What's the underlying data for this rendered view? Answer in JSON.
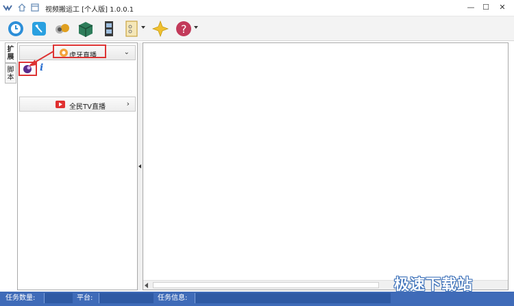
{
  "window": {
    "title": "视频搬运工 [个人版] 1.0.0.1",
    "controls": {
      "minimize": "—",
      "maximize": "☐",
      "close": "✕"
    }
  },
  "toolbar": {
    "buttons": [
      {
        "icon": "clock-icon",
        "color": "#2d8fd8"
      },
      {
        "icon": "scissor-icon",
        "color": "#2aa0e0"
      },
      {
        "icon": "coins-icon",
        "color": "#888888"
      },
      {
        "icon": "box-icon",
        "color": "#2e7d5b"
      },
      {
        "icon": "film-icon",
        "color": "#444444"
      },
      {
        "icon": "document-icon",
        "color": "#e0b84a"
      },
      {
        "icon": "star-icon",
        "color": "#f0c030"
      },
      {
        "icon": "help-icon",
        "color": "#c23a5a"
      }
    ]
  },
  "left_tabs": [
    {
      "label": "扩展",
      "active": true
    },
    {
      "label": "脚本",
      "active": false
    }
  ],
  "accordion": {
    "sections": [
      {
        "label": "虎牙直播",
        "expanded": true,
        "chevron": "⌄",
        "items": [
          {
            "icon": "huya-plugin-icon"
          },
          {
            "icon": "info-icon",
            "text": "i"
          }
        ]
      },
      {
        "label": "全民TV直播",
        "expanded": false,
        "chevron": "›"
      }
    ]
  },
  "status_bar": {
    "task_count_label": "任务数量:",
    "platform_label": "平台:",
    "task_info_label": "任务信息:"
  },
  "watermark": "极速下载站"
}
